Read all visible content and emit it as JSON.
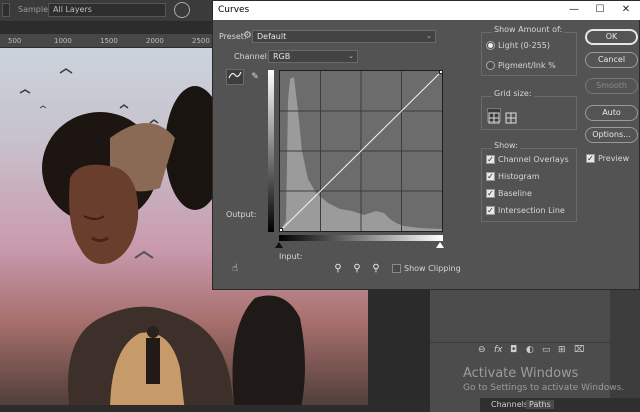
{
  "background": {
    "options_bar": {
      "sample_label": "Sample:",
      "sample_value": "All Layers"
    },
    "ruler_ticks": [
      "500",
      "1000",
      "1500",
      "2000",
      "2500"
    ],
    "panel_icons": [
      "link-icon",
      "fx-icon",
      "mask-icon",
      "adjustment-icon",
      "folder-icon",
      "new-layer-icon",
      "trash-icon"
    ],
    "panel_fx_label": "fx",
    "bottom_tabs": [
      "Channels",
      "Paths"
    ],
    "watermark": {
      "title": "Activate Windows",
      "subtitle": "Go to Settings to activate Windows."
    }
  },
  "dialog": {
    "title": "Curves",
    "window_buttons": {
      "minimize": "—",
      "maximize": "☐",
      "close": "✕"
    },
    "preset_label": "Preset:",
    "preset_value": "Default",
    "channel_label": "Channel:",
    "channel_value": "RGB",
    "output_label": "Output:",
    "input_label": "Input:",
    "show_clipping_label": "Show Clipping",
    "show_clipping_checked": false,
    "show_amount": {
      "title": "Show Amount of:",
      "options": [
        {
          "label": "Light  (0-255)",
          "selected": true
        },
        {
          "label": "Pigment/Ink %",
          "selected": false
        }
      ]
    },
    "grid_size_label": "Grid size:",
    "grid_size_selected": "4x4",
    "show": {
      "title": "Show:",
      "options": [
        {
          "label": "Channel Overlays",
          "checked": true
        },
        {
          "label": "Histogram",
          "checked": true
        },
        {
          "label": "Baseline",
          "checked": true
        },
        {
          "label": "Intersection Line",
          "checked": true
        }
      ]
    },
    "buttons": {
      "ok": "OK",
      "cancel": "Cancel",
      "smooth": "Smooth",
      "auto": "Auto",
      "options": "Options..."
    },
    "preview_label": "Preview",
    "preview_checked": true,
    "curve_points": [
      [
        0,
        0
      ],
      [
        255,
        255
      ]
    ],
    "histogram": [
      0,
      0,
      0,
      0,
      0,
      0,
      0,
      0,
      0,
      0,
      0,
      0,
      0,
      0,
      0,
      0,
      0,
      0,
      0,
      0,
      0,
      0,
      0,
      0,
      0,
      0,
      0,
      0,
      0,
      0,
      0,
      0,
      0,
      0,
      0,
      0,
      0,
      0,
      0,
      0,
      0,
      0,
      0,
      0,
      0,
      0,
      0,
      0,
      0,
      0,
      0,
      0,
      0,
      0,
      0,
      0,
      0,
      0,
      0,
      0,
      0,
      0,
      0,
      0,
      0,
      0,
      0,
      0,
      0,
      0
    ]
  }
}
